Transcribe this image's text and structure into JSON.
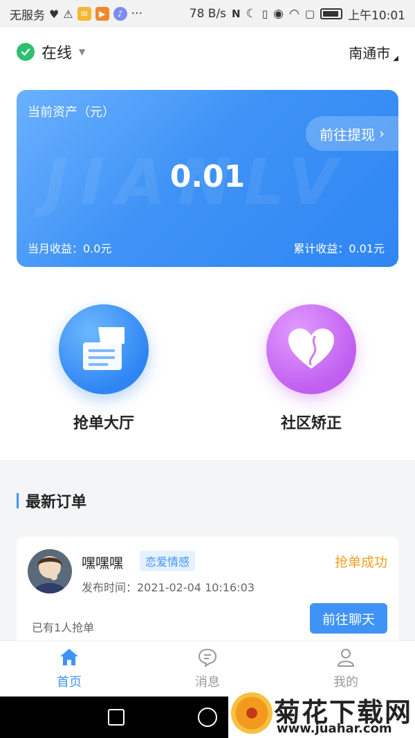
{
  "status_bar": {
    "carrier": "无服务",
    "speed": "78 B/s",
    "time": "上午10:01"
  },
  "header": {
    "online_label": "在线",
    "city": "南通市"
  },
  "asset_card": {
    "watermark": "JIANLV",
    "label": "当前资产（元）",
    "withdraw_button": "前往提现",
    "value": "0.01",
    "month_income": "当月收益：0.0元",
    "total_income": "累计收益：0.01元"
  },
  "features": [
    {
      "label": "抢单大厅",
      "icon": "hand-card-icon"
    },
    {
      "label": "社区矫正",
      "icon": "heart-icon"
    }
  ],
  "latest_orders": {
    "title": "最新订单",
    "items": [
      {
        "username": "嘿嘿嘿",
        "tag": "恋爱情感",
        "status": "抢单成功",
        "publish_time": "发布时间：2021-02-04 10:16:03",
        "grab_count": "已有1人抢单",
        "chat_button": "前往聊天"
      }
    ]
  },
  "tabbar": [
    {
      "label": "首页",
      "icon": "home-icon",
      "active": true
    },
    {
      "label": "消息",
      "icon": "message-icon",
      "active": false
    },
    {
      "label": "我的",
      "icon": "user-icon",
      "active": false
    }
  ],
  "watermark_site": {
    "title": "菊花下载网",
    "url": "www.juahar.com"
  },
  "colors": {
    "accent": "#3f93f6",
    "online_green": "#2fbf71",
    "status_orange": "#f0a020",
    "feature_blue": "#2f86f3",
    "feature_purple": "#c05ef0"
  }
}
